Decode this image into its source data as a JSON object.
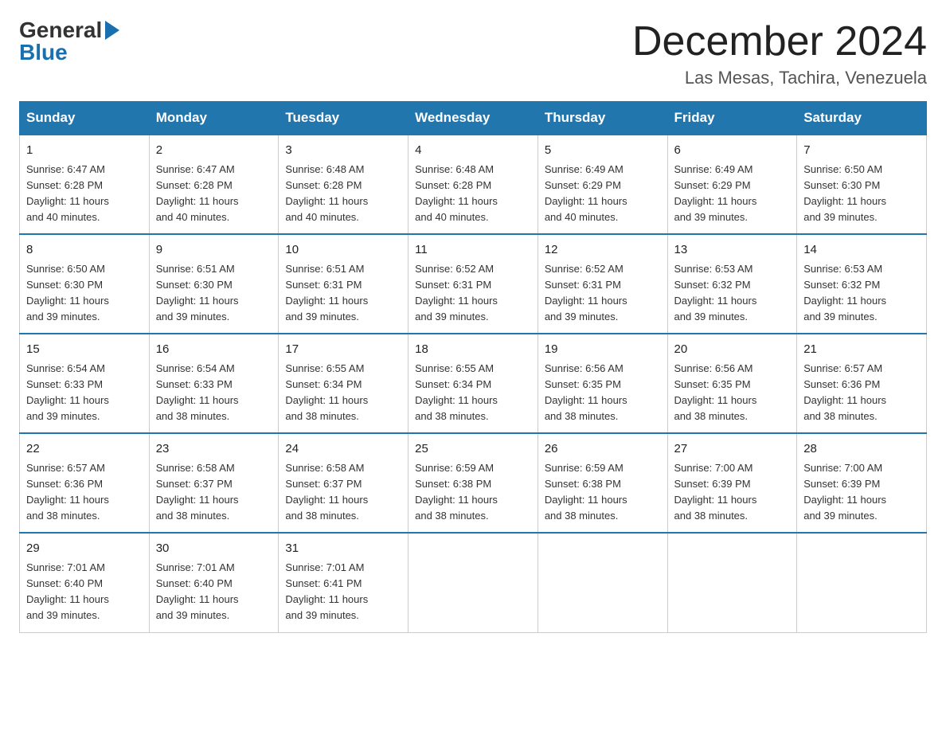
{
  "logo": {
    "general": "General",
    "blue": "Blue"
  },
  "title": {
    "month": "December 2024",
    "location": "Las Mesas, Tachira, Venezuela"
  },
  "headers": [
    "Sunday",
    "Monday",
    "Tuesday",
    "Wednesday",
    "Thursday",
    "Friday",
    "Saturday"
  ],
  "weeks": [
    [
      {
        "day": "1",
        "info": "Sunrise: 6:47 AM\nSunset: 6:28 PM\nDaylight: 11 hours\nand 40 minutes."
      },
      {
        "day": "2",
        "info": "Sunrise: 6:47 AM\nSunset: 6:28 PM\nDaylight: 11 hours\nand 40 minutes."
      },
      {
        "day": "3",
        "info": "Sunrise: 6:48 AM\nSunset: 6:28 PM\nDaylight: 11 hours\nand 40 minutes."
      },
      {
        "day": "4",
        "info": "Sunrise: 6:48 AM\nSunset: 6:28 PM\nDaylight: 11 hours\nand 40 minutes."
      },
      {
        "day": "5",
        "info": "Sunrise: 6:49 AM\nSunset: 6:29 PM\nDaylight: 11 hours\nand 40 minutes."
      },
      {
        "day": "6",
        "info": "Sunrise: 6:49 AM\nSunset: 6:29 PM\nDaylight: 11 hours\nand 39 minutes."
      },
      {
        "day": "7",
        "info": "Sunrise: 6:50 AM\nSunset: 6:30 PM\nDaylight: 11 hours\nand 39 minutes."
      }
    ],
    [
      {
        "day": "8",
        "info": "Sunrise: 6:50 AM\nSunset: 6:30 PM\nDaylight: 11 hours\nand 39 minutes."
      },
      {
        "day": "9",
        "info": "Sunrise: 6:51 AM\nSunset: 6:30 PM\nDaylight: 11 hours\nand 39 minutes."
      },
      {
        "day": "10",
        "info": "Sunrise: 6:51 AM\nSunset: 6:31 PM\nDaylight: 11 hours\nand 39 minutes."
      },
      {
        "day": "11",
        "info": "Sunrise: 6:52 AM\nSunset: 6:31 PM\nDaylight: 11 hours\nand 39 minutes."
      },
      {
        "day": "12",
        "info": "Sunrise: 6:52 AM\nSunset: 6:31 PM\nDaylight: 11 hours\nand 39 minutes."
      },
      {
        "day": "13",
        "info": "Sunrise: 6:53 AM\nSunset: 6:32 PM\nDaylight: 11 hours\nand 39 minutes."
      },
      {
        "day": "14",
        "info": "Sunrise: 6:53 AM\nSunset: 6:32 PM\nDaylight: 11 hours\nand 39 minutes."
      }
    ],
    [
      {
        "day": "15",
        "info": "Sunrise: 6:54 AM\nSunset: 6:33 PM\nDaylight: 11 hours\nand 39 minutes."
      },
      {
        "day": "16",
        "info": "Sunrise: 6:54 AM\nSunset: 6:33 PM\nDaylight: 11 hours\nand 38 minutes."
      },
      {
        "day": "17",
        "info": "Sunrise: 6:55 AM\nSunset: 6:34 PM\nDaylight: 11 hours\nand 38 minutes."
      },
      {
        "day": "18",
        "info": "Sunrise: 6:55 AM\nSunset: 6:34 PM\nDaylight: 11 hours\nand 38 minutes."
      },
      {
        "day": "19",
        "info": "Sunrise: 6:56 AM\nSunset: 6:35 PM\nDaylight: 11 hours\nand 38 minutes."
      },
      {
        "day": "20",
        "info": "Sunrise: 6:56 AM\nSunset: 6:35 PM\nDaylight: 11 hours\nand 38 minutes."
      },
      {
        "day": "21",
        "info": "Sunrise: 6:57 AM\nSunset: 6:36 PM\nDaylight: 11 hours\nand 38 minutes."
      }
    ],
    [
      {
        "day": "22",
        "info": "Sunrise: 6:57 AM\nSunset: 6:36 PM\nDaylight: 11 hours\nand 38 minutes."
      },
      {
        "day": "23",
        "info": "Sunrise: 6:58 AM\nSunset: 6:37 PM\nDaylight: 11 hours\nand 38 minutes."
      },
      {
        "day": "24",
        "info": "Sunrise: 6:58 AM\nSunset: 6:37 PM\nDaylight: 11 hours\nand 38 minutes."
      },
      {
        "day": "25",
        "info": "Sunrise: 6:59 AM\nSunset: 6:38 PM\nDaylight: 11 hours\nand 38 minutes."
      },
      {
        "day": "26",
        "info": "Sunrise: 6:59 AM\nSunset: 6:38 PM\nDaylight: 11 hours\nand 38 minutes."
      },
      {
        "day": "27",
        "info": "Sunrise: 7:00 AM\nSunset: 6:39 PM\nDaylight: 11 hours\nand 38 minutes."
      },
      {
        "day": "28",
        "info": "Sunrise: 7:00 AM\nSunset: 6:39 PM\nDaylight: 11 hours\nand 39 minutes."
      }
    ],
    [
      {
        "day": "29",
        "info": "Sunrise: 7:01 AM\nSunset: 6:40 PM\nDaylight: 11 hours\nand 39 minutes."
      },
      {
        "day": "30",
        "info": "Sunrise: 7:01 AM\nSunset: 6:40 PM\nDaylight: 11 hours\nand 39 minutes."
      },
      {
        "day": "31",
        "info": "Sunrise: 7:01 AM\nSunset: 6:41 PM\nDaylight: 11 hours\nand 39 minutes."
      },
      null,
      null,
      null,
      null
    ]
  ]
}
